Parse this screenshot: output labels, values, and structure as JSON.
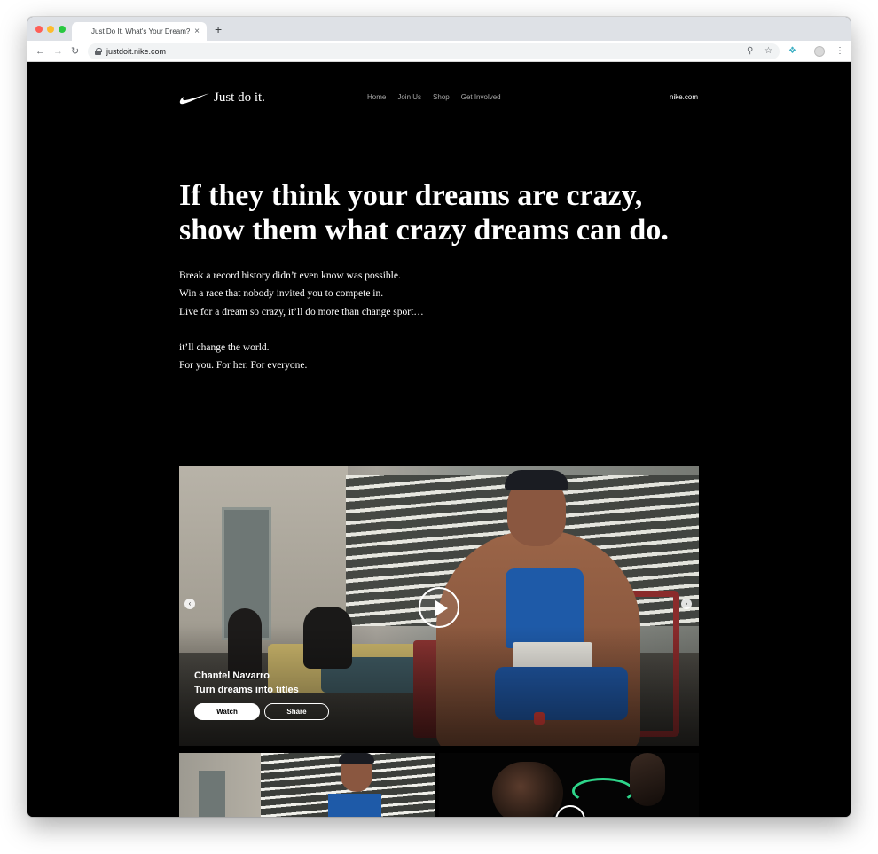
{
  "browser": {
    "tab_title": "Just Do It. What's Your Dream?",
    "tab_close": "×",
    "new_tab": "+",
    "url": "justdoit.nike.com",
    "icons": [
      "back-arrow-icon",
      "forward-arrow-icon",
      "reload-icon",
      "lock-icon",
      "zoom-icon",
      "star-icon",
      "extension-icon",
      "profile-icon",
      "menu-icon"
    ]
  },
  "header": {
    "wordmark": "Just do it.",
    "nav": [
      "Home",
      "Join Us",
      "Shop",
      "Get Involved"
    ],
    "external_link": "nike.com"
  },
  "hero_text": {
    "headline": [
      "If they think your dreams are crazy,",
      "show them what crazy dreams can do."
    ],
    "paragraph_1": [
      "Break a record history didn’t even know was possible.",
      "Win a race that nobody invited you to compete in.",
      "Live for a dream so crazy, it’ll do more than change sport…"
    ],
    "paragraph_2": [
      "it’ll change the world.",
      "For you. For her. For everyone."
    ]
  },
  "featured_video": {
    "athlete_name": "Chantel Navarro",
    "subtitle": "Turn dreams into titles",
    "watch_label": "Watch",
    "share_label": "Share",
    "prev_arrow": "‹",
    "next_arrow": "›"
  },
  "colors": {
    "page_background": "#000000",
    "text": "#ffffff",
    "nav_text": "#a8a8a8",
    "tabstrip": "#dee1e6"
  }
}
